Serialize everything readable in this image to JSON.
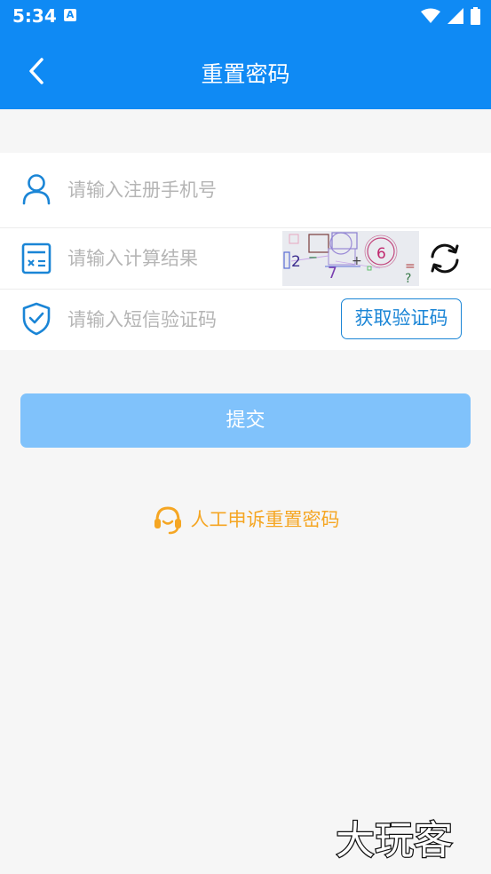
{
  "status_bar": {
    "time": "5:34",
    "notification_letter": "A"
  },
  "header": {
    "title": "重置密码"
  },
  "form": {
    "phone": {
      "placeholder": "请输入注册手机号"
    },
    "calc": {
      "placeholder": "请输入计算结果",
      "captcha": {
        "glyphs": [
          "2",
          "−",
          "7",
          "+",
          "6",
          "=",
          "?"
        ]
      }
    },
    "sms": {
      "placeholder": "请输入短信验证码",
      "button_label": "获取验证码"
    }
  },
  "submit_label": "提交",
  "appeal_label": "人工申诉重置密码",
  "watermark_text": "大玩客",
  "colors": {
    "primary": "#0f8af4",
    "submit_disabled": "#80c2fb",
    "appeal": "#f5a623",
    "outline_button": "#1a85d6"
  }
}
